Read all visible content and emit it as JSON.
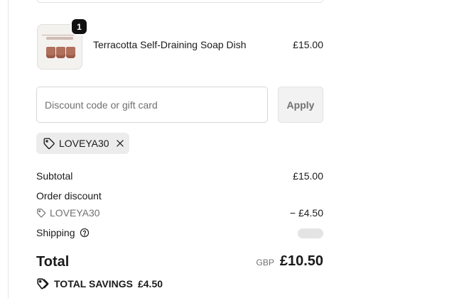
{
  "product": {
    "name": "Terracotta Self-Draining Soap Dish",
    "price": "£15.00",
    "quantity": "1"
  },
  "discount_field": {
    "placeholder": "Discount code or gift card",
    "value": "",
    "apply_label": "Apply"
  },
  "applied_code": {
    "code": "LOVEYA30",
    "icon": "tag-icon",
    "remove_icon": "close-icon"
  },
  "summary": {
    "subtotal_label": "Subtotal",
    "subtotal_value": "£15.00",
    "order_discount_label": "Order discount",
    "discount_code": "LOVEYA30",
    "discount_value": "− £4.50",
    "shipping_label": "Shipping",
    "total_label": "Total",
    "currency": "GBP",
    "total_value": "£10.50",
    "savings_label": "TOTAL SAVINGS",
    "savings_value": "£4.50"
  }
}
